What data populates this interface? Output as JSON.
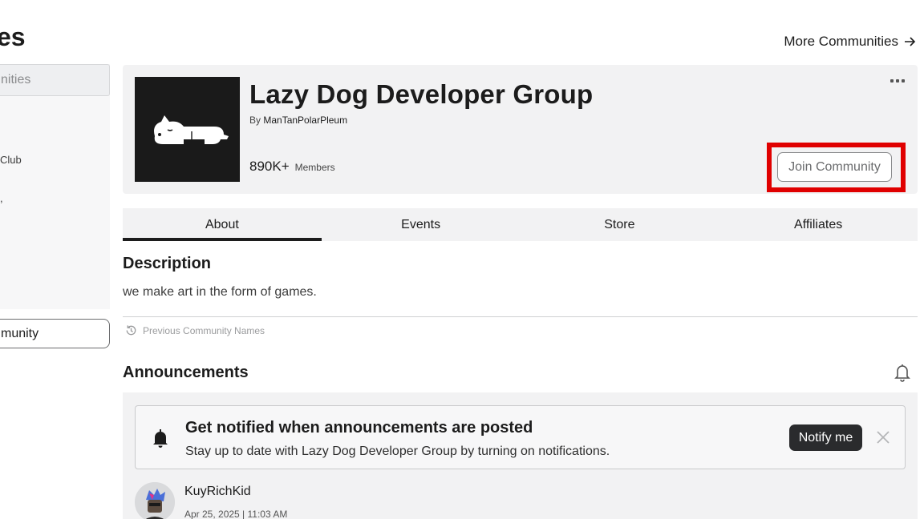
{
  "page": {
    "title_fragment": "es",
    "more_link": "More Communities"
  },
  "sidebar": {
    "search_placeholder": "nities",
    "items": [
      {
        "label": "Club"
      },
      {
        "label": ","
      }
    ],
    "create_button": "munity"
  },
  "community": {
    "name": "Lazy Dog Developer Group",
    "by_prefix": "By",
    "owner": "ManTanPolarPleum",
    "member_count": "890K+",
    "member_label": "Members",
    "join_button": "Join Community"
  },
  "tabs": [
    {
      "label": "About",
      "active": true
    },
    {
      "label": "Events",
      "active": false
    },
    {
      "label": "Store",
      "active": false
    },
    {
      "label": "Affiliates",
      "active": false
    }
  ],
  "about": {
    "description_heading": "Description",
    "description": "we make art in the form of games.",
    "previous_names": "Previous Community Names"
  },
  "announcements": {
    "heading": "Announcements",
    "notify_title": "Get notified when announcements are posted",
    "notify_text": "Stay up to date with Lazy Dog Developer Group by turning on notifications.",
    "notify_button": "Notify me"
  },
  "post": {
    "user": "KuyRichKid",
    "date": "Apr 25, 2025 | 11:03 AM"
  },
  "colors": {
    "highlight": "#e00000",
    "accent_dark": "#2a2b2d",
    "card_bg": "#f2f2f3"
  },
  "icons": [
    "arrow-right-icon",
    "more-options-icon",
    "history-icon",
    "bell-icon",
    "close-icon",
    "dog-logo"
  ]
}
